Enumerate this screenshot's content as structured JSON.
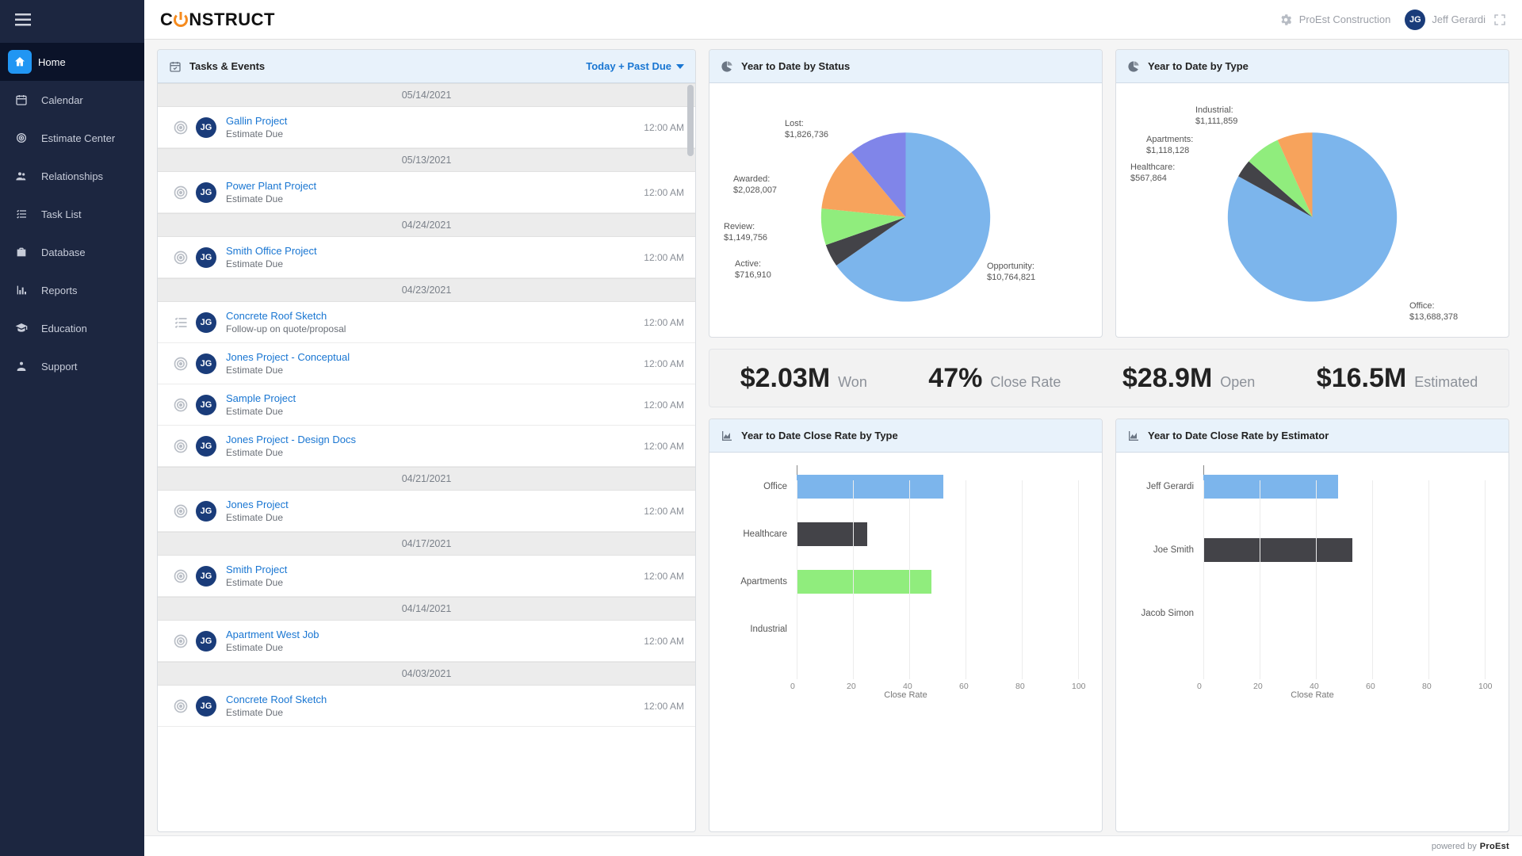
{
  "brand": "CONSTRUCT",
  "topbar": {
    "org_name": "ProEst Construction",
    "user_name": "Jeff Gerardi",
    "user_initials": "JG"
  },
  "sidebar": {
    "items": [
      {
        "label": "Home",
        "icon": "home-icon",
        "active": true
      },
      {
        "label": "Calendar",
        "icon": "calendar-icon"
      },
      {
        "label": "Estimate Center",
        "icon": "target-icon"
      },
      {
        "label": "Relationships",
        "icon": "people-icon"
      },
      {
        "label": "Task List",
        "icon": "tasklist-icon"
      },
      {
        "label": "Database",
        "icon": "briefcase-icon"
      },
      {
        "label": "Reports",
        "icon": "chart-icon"
      },
      {
        "label": "Education",
        "icon": "grad-icon"
      },
      {
        "label": "Support",
        "icon": "support-icon"
      }
    ]
  },
  "tasks_panel": {
    "title": "Tasks & Events",
    "filter_label": "Today + Past Due",
    "groups": [
      {
        "date": "05/14/2021",
        "items": [
          {
            "title": "Gallin Project",
            "sub": "Estimate Due",
            "time": "12:00 AM",
            "initials": "JG",
            "type": "target"
          }
        ]
      },
      {
        "date": "05/13/2021",
        "items": [
          {
            "title": "Power Plant Project",
            "sub": "Estimate Due",
            "time": "12:00 AM",
            "initials": "JG",
            "type": "target"
          }
        ]
      },
      {
        "date": "04/24/2021",
        "items": [
          {
            "title": "Smith Office Project",
            "sub": "Estimate Due",
            "time": "12:00 AM",
            "initials": "JG",
            "type": "target"
          }
        ]
      },
      {
        "date": "04/23/2021",
        "items": [
          {
            "title": "Concrete Roof Sketch",
            "sub": "Follow-up on quote/proposal",
            "time": "12:00 AM",
            "initials": "JG",
            "type": "checklist"
          },
          {
            "title": "Jones Project - Conceptual",
            "sub": "Estimate Due",
            "time": "12:00 AM",
            "initials": "JG",
            "type": "target"
          },
          {
            "title": "Sample Project",
            "sub": "Estimate Due",
            "time": "12:00 AM",
            "initials": "JG",
            "type": "target"
          },
          {
            "title": "Jones Project - Design Docs",
            "sub": "Estimate Due",
            "time": "12:00 AM",
            "initials": "JG",
            "type": "target"
          }
        ]
      },
      {
        "date": "04/21/2021",
        "items": [
          {
            "title": "Jones Project",
            "sub": "Estimate Due",
            "time": "12:00 AM",
            "initials": "JG",
            "type": "target"
          }
        ]
      },
      {
        "date": "04/17/2021",
        "items": [
          {
            "title": "Smith Project",
            "sub": "Estimate Due",
            "time": "12:00 AM",
            "initials": "JG",
            "type": "target"
          }
        ]
      },
      {
        "date": "04/14/2021",
        "items": [
          {
            "title": "Apartment West Job",
            "sub": "Estimate Due",
            "time": "12:00 AM",
            "initials": "JG",
            "type": "target"
          }
        ]
      },
      {
        "date": "04/03/2021",
        "items": [
          {
            "title": "Concrete Roof Sketch",
            "sub": "Estimate Due",
            "time": "12:00 AM",
            "initials": "JG",
            "type": "target"
          }
        ]
      }
    ]
  },
  "pie_status": {
    "title": "Year to Date by Status"
  },
  "pie_type": {
    "title": "Year to Date by Type"
  },
  "kpis": [
    {
      "value": "$2.03M",
      "label": "Won"
    },
    {
      "value": "47%",
      "label": "Close Rate"
    },
    {
      "value": "$28.9M",
      "label": "Open"
    },
    {
      "value": "$16.5M",
      "label": "Estimated"
    }
  ],
  "bar_type": {
    "title": "Year to Date Close Rate by Type",
    "axis": "Close Rate"
  },
  "bar_est": {
    "title": "Year to Date Close Rate by Estimator",
    "axis": "Close Rate"
  },
  "footer": {
    "powered": "powered by",
    "brand": "ProEst"
  },
  "chart_data": {
    "ytd_status": {
      "type": "pie",
      "title": "Year to Date by Status",
      "slices": [
        {
          "name": "Opportunity",
          "value": 10764821,
          "display": "$10,764,821",
          "color": "#7cb5ec"
        },
        {
          "name": "Active",
          "value": 716910,
          "display": "$716,910",
          "color": "#434348"
        },
        {
          "name": "Review",
          "value": 1149756,
          "display": "$1,149,756",
          "color": "#90ed7d"
        },
        {
          "name": "Awarded",
          "value": 2028007,
          "display": "$2,028,007",
          "color": "#f7a35c"
        },
        {
          "name": "Lost",
          "value": 1826736,
          "display": "$1,826,736",
          "color": "#8085e9"
        }
      ]
    },
    "ytd_type": {
      "type": "pie",
      "title": "Year to Date by Type",
      "slices": [
        {
          "name": "Office",
          "value": 13688378,
          "display": "$13,688,378",
          "color": "#7cb5ec"
        },
        {
          "name": "Healthcare",
          "value": 567864,
          "display": "$567,864",
          "color": "#434348"
        },
        {
          "name": "Apartments",
          "value": 1118128,
          "display": "$1,118,128",
          "color": "#90ed7d"
        },
        {
          "name": "Industrial",
          "value": 1111859,
          "display": "$1,111,859",
          "color": "#f7a35c"
        }
      ]
    },
    "close_rate_type": {
      "type": "bar",
      "orientation": "horizontal",
      "title": "Year to Date Close Rate by Type",
      "xlabel": "Close Rate",
      "xlim": [
        0,
        100
      ],
      "xticks": [
        0,
        20,
        40,
        60,
        80,
        100
      ],
      "categories": [
        "Office",
        "Healthcare",
        "Apartments",
        "Industrial"
      ],
      "values": [
        52,
        25,
        48,
        0
      ],
      "colors": [
        "#7cb5ec",
        "#434348",
        "#90ed7d",
        "#f7a35c"
      ]
    },
    "close_rate_estimator": {
      "type": "bar",
      "orientation": "horizontal",
      "title": "Year to Date Close Rate by Estimator",
      "xlabel": "Close Rate",
      "xlim": [
        0,
        100
      ],
      "xticks": [
        0,
        20,
        40,
        60,
        80,
        100
      ],
      "categories": [
        "Jeff Gerardi",
        "Joe Smith",
        "Jacob Simon"
      ],
      "values": [
        48,
        53,
        0
      ],
      "colors": [
        "#7cb5ec",
        "#434348",
        "#90ed7d"
      ]
    }
  }
}
